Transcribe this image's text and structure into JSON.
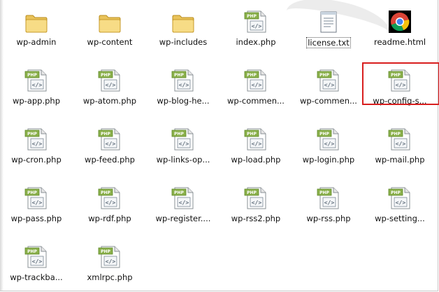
{
  "folder": {
    "items": [
      {
        "label": "wp-admin",
        "icon": "folder-icon"
      },
      {
        "label": "wp-content",
        "icon": "folder-icon"
      },
      {
        "label": "wp-includes",
        "icon": "folder-icon"
      },
      {
        "label": "index.php",
        "icon": "php-file-icon"
      },
      {
        "label": "license.txt",
        "icon": "text-file-icon",
        "focused": true
      },
      {
        "label": "readme.html",
        "icon": "chrome-browser-icon"
      },
      {
        "label": "wp-app.php",
        "icon": "php-file-icon"
      },
      {
        "label": "wp-atom.php",
        "icon": "php-file-icon"
      },
      {
        "label": "wp-blog-he...",
        "icon": "php-file-icon"
      },
      {
        "label": "wp-commen...",
        "icon": "php-file-icon"
      },
      {
        "label": "wp-commen...",
        "icon": "php-file-icon"
      },
      {
        "label": "wp-config-s...",
        "icon": "php-file-icon",
        "highlighted": true
      },
      {
        "label": "wp-cron.php",
        "icon": "php-file-icon"
      },
      {
        "label": "wp-feed.php",
        "icon": "php-file-icon"
      },
      {
        "label": "wp-links-op...",
        "icon": "php-file-icon"
      },
      {
        "label": "wp-load.php",
        "icon": "php-file-icon"
      },
      {
        "label": "wp-login.php",
        "icon": "php-file-icon"
      },
      {
        "label": "wp-mail.php",
        "icon": "php-file-icon"
      },
      {
        "label": "wp-pass.php",
        "icon": "php-file-icon"
      },
      {
        "label": "wp-rdf.php",
        "icon": "php-file-icon"
      },
      {
        "label": "wp-register....",
        "icon": "php-file-icon"
      },
      {
        "label": "wp-rss2.php",
        "icon": "php-file-icon"
      },
      {
        "label": "wp-rss.php",
        "icon": "php-file-icon"
      },
      {
        "label": "wp-setting...",
        "icon": "php-file-icon"
      },
      {
        "label": "wp-trackba...",
        "icon": "php-file-icon"
      },
      {
        "label": "xmlrpc.php",
        "icon": "php-file-icon"
      }
    ]
  },
  "icon_badges": {
    "php": "PHP",
    "code": "</>"
  },
  "colors": {
    "highlight": "#d81e1e",
    "folder": "#f2d57a",
    "php_badge": "#8ab04a"
  }
}
